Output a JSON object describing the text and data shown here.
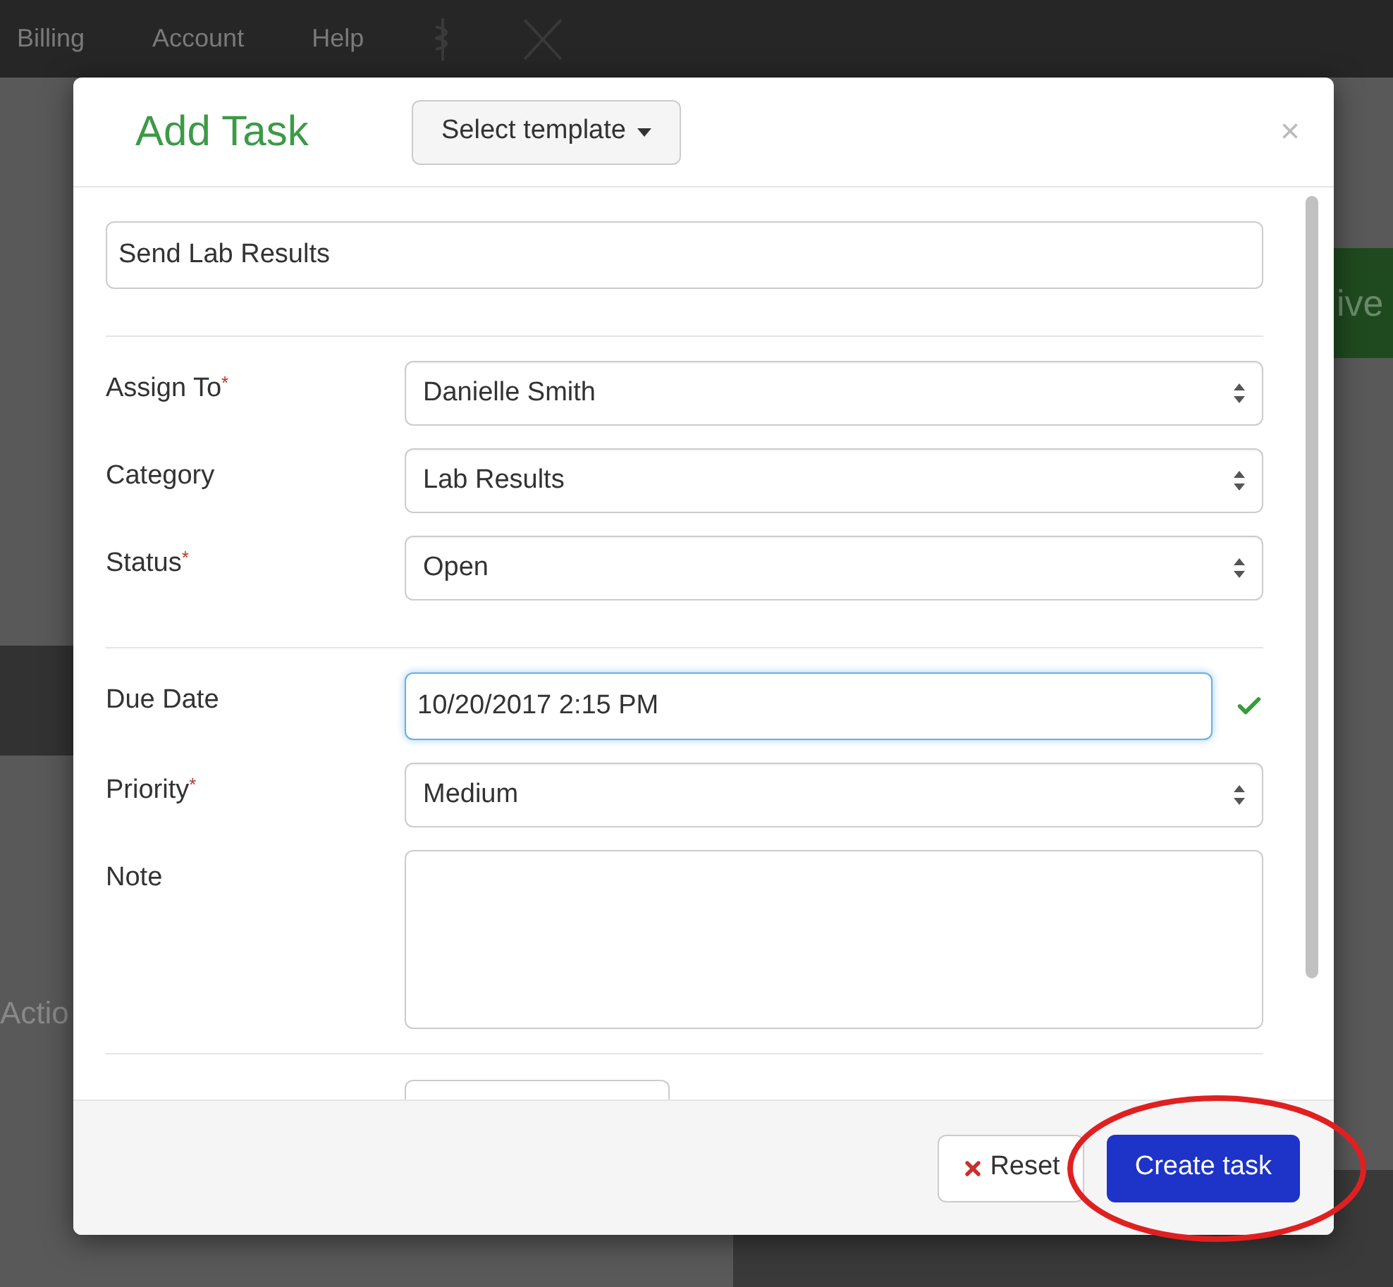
{
  "nav": {
    "items": [
      "Billing",
      "Account",
      "Help"
    ]
  },
  "background": {
    "fragments": [
      "ive",
      "Actio"
    ]
  },
  "modal": {
    "title": "Add Task",
    "template_button": "Select template",
    "close": "×",
    "task_name": {
      "value": "Send Lab Results"
    },
    "groups": [
      [
        {
          "kind": "select",
          "label": "Assign To",
          "mark": "*",
          "value": "Danielle Smith"
        },
        {
          "kind": "select",
          "label": "Category",
          "value": "Lab Results"
        },
        {
          "kind": "select",
          "label": "Status",
          "mark": "*",
          "value": "Open"
        }
      ],
      [
        {
          "kind": "date",
          "label": "Due Date",
          "value": "10/20/2017 2:15 PM",
          "focused": true,
          "valid": true
        },
        {
          "kind": "select",
          "label": "Priority",
          "mark": "*",
          "value": "Medium"
        },
        {
          "kind": "textarea",
          "label": "Note"
        }
      ]
    ],
    "buttons": [
      {
        "kind": "reset",
        "label": "Reset",
        "highlighted": false
      },
      {
        "kind": "primary",
        "label": "Create task",
        "highlighted": true
      }
    ]
  }
}
